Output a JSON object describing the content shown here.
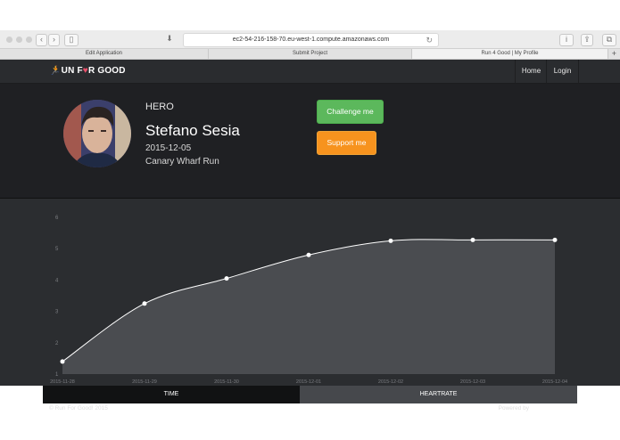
{
  "browser": {
    "url": "ec2-54-216-158-70.eu-west-1.compute.amazonaws.com",
    "tabs": [
      {
        "label": "Edit Application"
      },
      {
        "label": "Submit Project"
      },
      {
        "label": "Run 4 Good | My Profile"
      }
    ]
  },
  "nav": {
    "brand": "UN F",
    "brand_mid": "R GOOD",
    "home": "Home",
    "login": "Login"
  },
  "hero": {
    "label": "HERO",
    "name": "Stefano Sesia",
    "date": "2015-12-05",
    "event": "Canary Wharf Run",
    "challenge": "Challenge me",
    "support": "Support me"
  },
  "chart_data": {
    "type": "area",
    "x": [
      "2015-11-28",
      "2015-11-29",
      "2015-11-30",
      "2015-12-01",
      "2015-12-02",
      "2015-12-03",
      "2015-12-04"
    ],
    "values": [
      1.4,
      3.25,
      4.05,
      4.8,
      5.25,
      5.28,
      5.28
    ],
    "ylim": [
      1,
      6
    ],
    "yticks": [
      "1",
      "2",
      "3",
      "4",
      "5",
      "6"
    ],
    "colors": {
      "fill": "#4a4c50",
      "line": "#ffffff",
      "point": "#ffffff"
    }
  },
  "segments": {
    "time": "TIME",
    "heartrate": "HEARTRATE"
  },
  "footer": {
    "copyright": "© Run For Good! 2015",
    "powered": "Powered by",
    "framework": "Yii Framework"
  },
  "colors": {
    "navbar": "#2a2c2f",
    "hero": "#1f2023",
    "challenge": "#5cb85c",
    "support": "#f7931e",
    "brand_icon": "#6fc7e0"
  }
}
